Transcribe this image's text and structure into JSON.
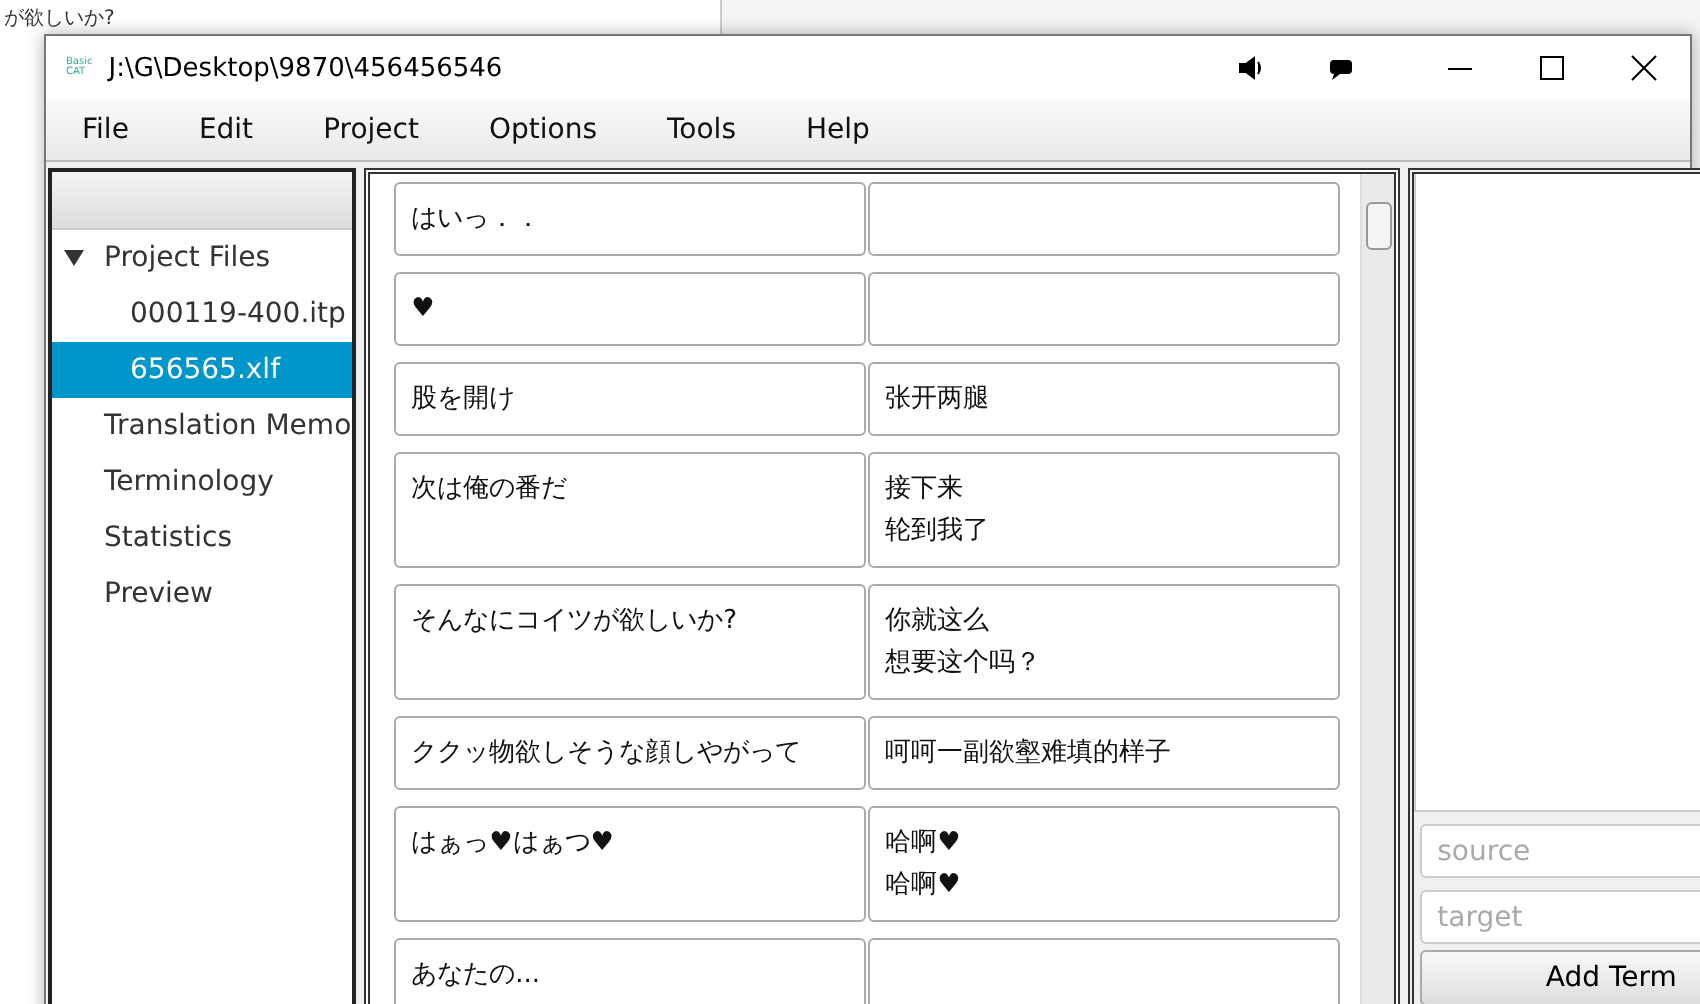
{
  "background_window": {
    "texts": [
      "が欲しいか?"
    ]
  },
  "window": {
    "title": "J:\\G\\Desktop\\9870\\456456546",
    "logo": [
      "Basic",
      "CAT"
    ]
  },
  "menu": [
    "File",
    "Edit",
    "Project",
    "Options",
    "Tools",
    "Help"
  ],
  "sidebar": {
    "items": [
      {
        "label": "Project Files",
        "expanded": true,
        "selected": false,
        "children": [
          {
            "label": "000119-400.itp",
            "selected": false
          },
          {
            "label": "656565.xlf",
            "selected": true
          }
        ]
      },
      {
        "label": "Translation Memo",
        "selected": false
      },
      {
        "label": "Terminology",
        "selected": false
      },
      {
        "label": "Statistics",
        "selected": false
      },
      {
        "label": "Preview",
        "selected": false
      }
    ]
  },
  "segments": [
    {
      "source": "はいっ．．"
    },
    {
      "source": "♥"
    },
    {
      "source": "股を開け",
      "target": [
        "张开两腿"
      ]
    },
    {
      "source": "次は俺の番だ",
      "target": [
        "接下来",
        "轮到我了"
      ]
    },
    {
      "source": "そんなにコイツが欲しいか?",
      "target": [
        "你就这么",
        "想要这个吗？"
      ]
    },
    {
      "source": "ククッ物欲しそうな顔しやがって",
      "target": [
        "呵呵一副欲壑难填的样子"
      ]
    },
    {
      "source": "はぁっ♥はぁつ♥",
      "target": [
        "哈啊♥",
        "哈啊♥"
      ]
    },
    {
      "source": "あなたの..."
    }
  ],
  "glossary": {
    "source_placeholder": "source",
    "target_placeholder": "target",
    "button": "Add Term"
  }
}
